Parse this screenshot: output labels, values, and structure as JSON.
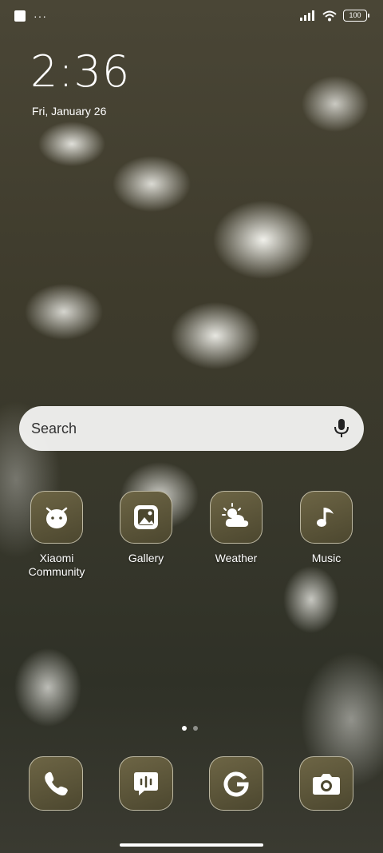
{
  "status_bar": {
    "notification_icons": [
      "square-notification-icon",
      "more-notifications-icon"
    ],
    "more_text": "···",
    "battery_level": "100",
    "signal_icon": "cell-signal-icon",
    "wifi_icon": "wifi-icon"
  },
  "clock": {
    "time": "2:36",
    "date": "Fri, January 26"
  },
  "search": {
    "placeholder": "Search",
    "mic_icon": "microphone-icon"
  },
  "apps": [
    {
      "label": "Xiaomi Community",
      "icon": "xiaomi-community-icon"
    },
    {
      "label": "Gallery",
      "icon": "gallery-icon"
    },
    {
      "label": "Weather",
      "icon": "weather-icon"
    },
    {
      "label": "Music",
      "icon": "music-icon"
    }
  ],
  "pager": {
    "pages": 2,
    "current": 1
  },
  "dock": [
    {
      "name": "Phone",
      "icon": "phone-icon"
    },
    {
      "name": "Messaging",
      "icon": "messaging-icon"
    },
    {
      "name": "Google",
      "icon": "google-icon"
    },
    {
      "name": "Camera",
      "icon": "camera-icon"
    }
  ],
  "colors": {
    "icon_bg": "#5d573c",
    "icon_border": "#e6e1cd",
    "search_bg": "#f8f8f6"
  }
}
